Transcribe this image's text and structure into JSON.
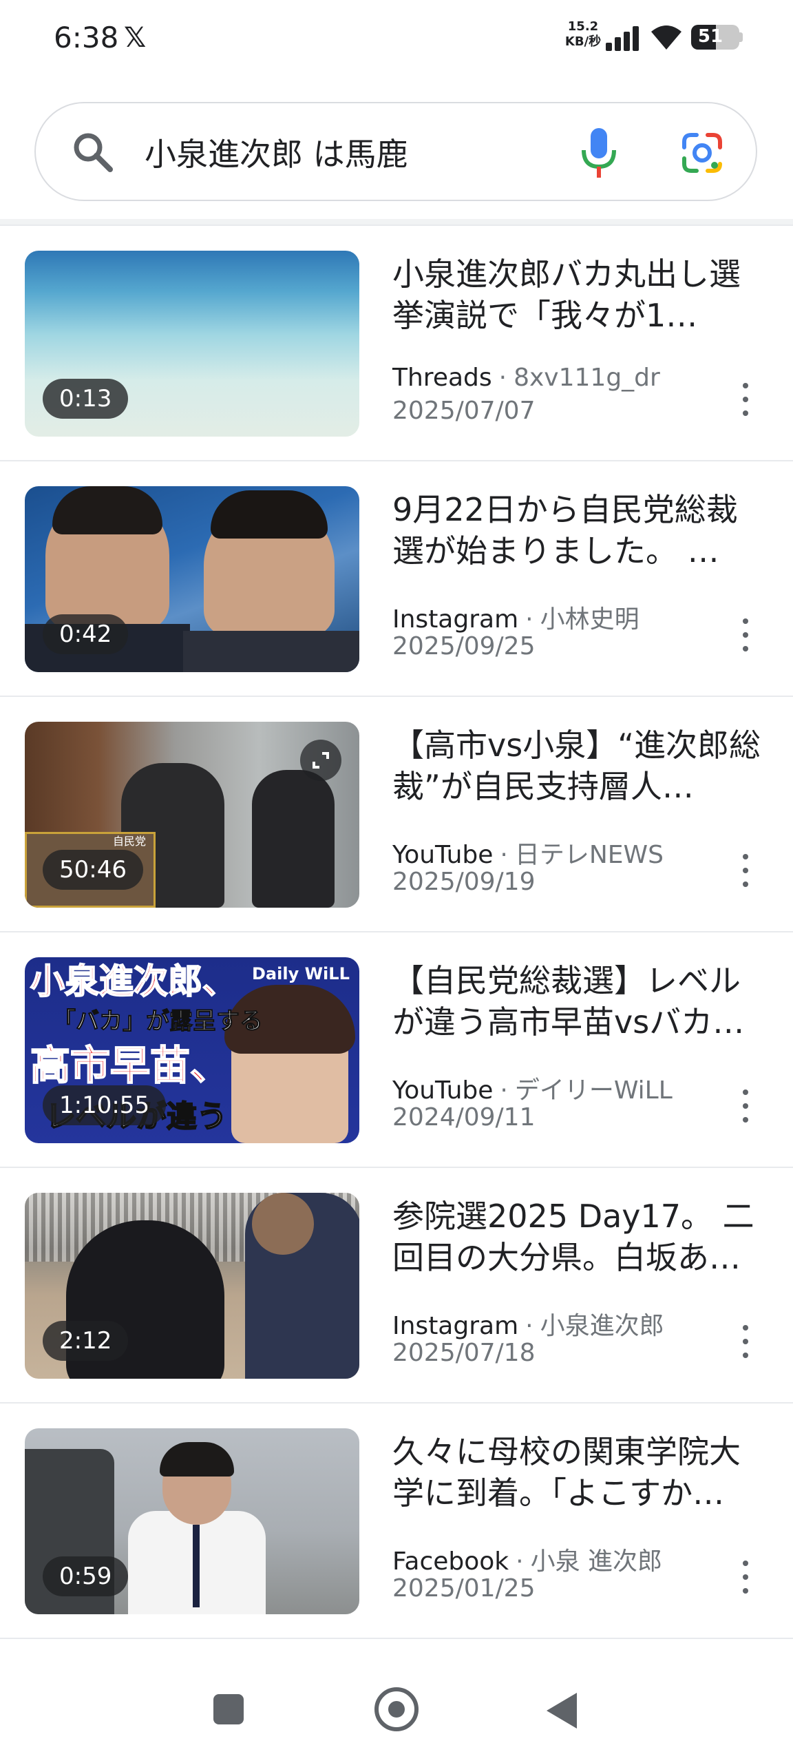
{
  "status_bar": {
    "time": "6:38",
    "app_icon": "x-logo",
    "net_speed_value": "15.2",
    "net_speed_unit": "KB/秒",
    "battery_level": "51",
    "battery_fraction": 0.51
  },
  "search": {
    "query": "小泉進次郎 は馬鹿",
    "left_icon": "search-icon",
    "voice_icon": "mic-icon",
    "lens_icon": "google-lens-icon"
  },
  "results": [
    {
      "title": "小泉進次郎バカ丸出し選挙演説で「我々が1…",
      "source": "Threads",
      "author": "8xv111g_dr",
      "date": "2025/07/07",
      "duration": "0:13",
      "thumb_style": "beach"
    },
    {
      "title": "9月22日から自民党総裁選が始まりました。 …",
      "source": "Instagram",
      "author": "小林史明",
      "date": "2025/09/25",
      "duration": "0:42",
      "thumb_style": "portrait-blue"
    },
    {
      "title": "【高市vs小泉】“進次郎総裁”が自民支持層人…",
      "source": "YouTube",
      "author": "日テレNEWS",
      "date": "2025/09/19",
      "duration": "50:46",
      "thumb_style": "news-hall",
      "thumb_text": "自民党"
    },
    {
      "title": "【自民党総裁選】レベルが違う高市早苗vsバカ…",
      "source": "YouTube",
      "author": "デイリーWiLL",
      "date": "2024/09/11",
      "duration": "1:10:55",
      "thumb_style": "will-caption",
      "thumb_lines": [
        "小泉進次郎、",
        "「バカ」が露呈する",
        "高市早苗、",
        "レベルが違う"
      ],
      "thumb_badge": "Daily WiLL"
    },
    {
      "title": "参院選2025 Day17。 二回目の大分県。白坂あ…",
      "source": "Instagram",
      "author": "小泉進次郎",
      "date": "2025/07/18",
      "duration": "2:12",
      "thumb_style": "crowd"
    },
    {
      "title": "久々に母校の関東学院大学に到着。「よこすか…",
      "source": "Facebook",
      "author": "小泉 進次郎",
      "date": "2025/01/25",
      "duration": "0:59",
      "thumb_style": "street"
    }
  ],
  "nav_bar": {
    "recent_icon": "recent-apps-icon",
    "home_icon": "home-icon",
    "back_icon": "back-icon"
  }
}
